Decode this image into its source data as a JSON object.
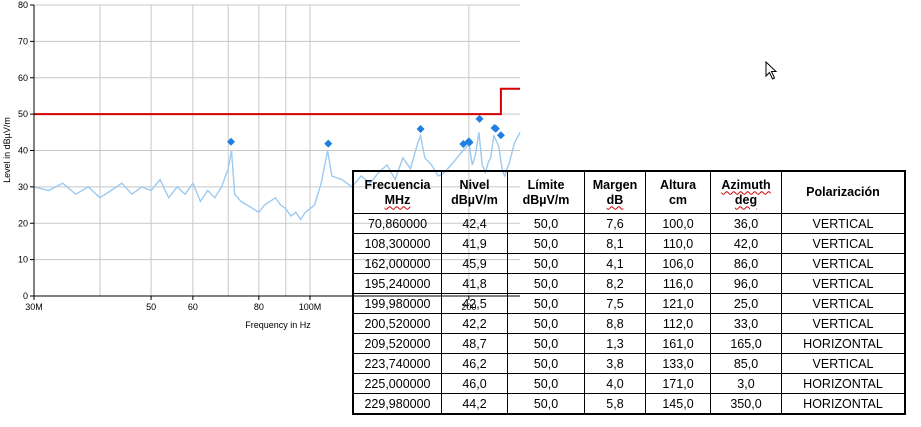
{
  "chart_data": {
    "type": "line",
    "ylabel": "Level in dBµV/m",
    "xlabel": "Frequency in Hz",
    "x_scale": "log",
    "xlim": [
      30,
      250
    ],
    "ylim": [
      0,
      80
    ],
    "y_ticks": [
      "0",
      "10",
      "20",
      "30",
      "40",
      "50",
      "60",
      "70",
      "80"
    ],
    "x_ticks": [
      {
        "label": "30M",
        "value": 30
      },
      {
        "label": "50",
        "value": 50
      },
      {
        "label": "60",
        "value": 60
      },
      {
        "label": "80",
        "value": 80
      },
      {
        "label": "100M",
        "value": 100
      },
      {
        "label": "200",
        "value": 200
      }
    ],
    "grid": true,
    "limit_line": {
      "color": "#d40000",
      "points": [
        [
          30,
          50
        ],
        [
          230,
          50
        ],
        [
          230,
          57
        ],
        [
          250,
          57
        ]
      ]
    },
    "trace": {
      "color": "#9ccaf1",
      "points": [
        [
          30,
          30
        ],
        [
          32,
          29
        ],
        [
          34,
          31
        ],
        [
          36,
          28
        ],
        [
          38,
          30
        ],
        [
          40,
          27
        ],
        [
          42,
          29
        ],
        [
          44,
          31
        ],
        [
          46,
          28
        ],
        [
          48,
          30
        ],
        [
          50,
          29
        ],
        [
          52,
          32
        ],
        [
          54,
          27
        ],
        [
          56,
          30
        ],
        [
          58,
          28
        ],
        [
          60,
          31
        ],
        [
          62,
          26
        ],
        [
          64,
          29
        ],
        [
          66,
          27
        ],
        [
          68,
          30
        ],
        [
          70,
          35
        ],
        [
          71,
          40
        ],
        [
          72,
          28
        ],
        [
          74,
          26
        ],
        [
          76,
          25
        ],
        [
          78,
          24
        ],
        [
          80,
          23
        ],
        [
          82,
          25
        ],
        [
          84,
          26
        ],
        [
          86,
          27
        ],
        [
          88,
          25
        ],
        [
          90,
          24
        ],
        [
          92,
          22
        ],
        [
          94,
          23
        ],
        [
          96,
          21
        ],
        [
          98,
          23
        ],
        [
          100,
          24
        ],
        [
          102,
          25
        ],
        [
          105,
          31
        ],
        [
          108,
          40
        ],
        [
          110,
          33
        ],
        [
          115,
          32
        ],
        [
          120,
          30
        ],
        [
          125,
          33
        ],
        [
          130,
          31
        ],
        [
          135,
          34
        ],
        [
          140,
          36
        ],
        [
          145,
          32
        ],
        [
          150,
          38
        ],
        [
          155,
          35
        ],
        [
          160,
          42
        ],
        [
          162,
          44
        ],
        [
          165,
          38
        ],
        [
          170,
          36
        ],
        [
          175,
          33
        ],
        [
          180,
          34
        ],
        [
          185,
          36
        ],
        [
          190,
          38
        ],
        [
          195,
          40
        ],
        [
          198,
          41
        ],
        [
          200,
          42
        ],
        [
          203,
          36
        ],
        [
          206,
          39
        ],
        [
          209,
          45
        ],
        [
          212,
          36
        ],
        [
          215,
          34
        ],
        [
          218,
          37
        ],
        [
          220,
          38
        ],
        [
          223,
          44
        ],
        [
          225,
          43
        ],
        [
          228,
          41
        ],
        [
          230,
          37
        ],
        [
          232,
          34
        ],
        [
          234,
          33
        ],
        [
          236,
          35
        ],
        [
          238,
          36
        ],
        [
          240,
          38
        ],
        [
          242,
          40
        ],
        [
          244,
          42
        ],
        [
          246,
          43
        ],
        [
          248,
          44
        ],
        [
          250,
          45
        ]
      ]
    },
    "markers": [
      {
        "x": 70.86,
        "y": 42.4
      },
      {
        "x": 108.3,
        "y": 41.9
      },
      {
        "x": 162.0,
        "y": 45.9
      },
      {
        "x": 195.24,
        "y": 41.8
      },
      {
        "x": 199.98,
        "y": 42.5
      },
      {
        "x": 200.52,
        "y": 42.2
      },
      {
        "x": 209.52,
        "y": 48.7
      },
      {
        "x": 223.74,
        "y": 46.2
      },
      {
        "x": 225.0,
        "y": 46.0
      },
      {
        "x": 229.98,
        "y": 44.2
      }
    ],
    "marker_color": "#1e7fe0"
  },
  "table": {
    "headers": [
      {
        "line1": "Frecuencia",
        "line2": "MHz"
      },
      {
        "line1": "Nivel",
        "line2": "dBµV/m"
      },
      {
        "line1": "Límite",
        "line2": "dBµV/m"
      },
      {
        "line1": "Margen",
        "line2": "dB"
      },
      {
        "line1": "Altura",
        "line2": "cm"
      },
      {
        "line1": "Azimuth",
        "line2": "deg"
      },
      {
        "line1": "Polarización",
        "line2": ""
      }
    ],
    "rows": [
      [
        "70,860000",
        "42,4",
        "50,0",
        "7,6",
        "100,0",
        "36,0",
        "VERTICAL"
      ],
      [
        "108,300000",
        "41,9",
        "50,0",
        "8,1",
        "110,0",
        "42,0",
        "VERTICAL"
      ],
      [
        "162,000000",
        "45,9",
        "50,0",
        "4,1",
        "106,0",
        "86,0",
        "VERTICAL"
      ],
      [
        "195,240000",
        "41,8",
        "50,0",
        "8,2",
        "116,0",
        "96,0",
        "VERTICAL"
      ],
      [
        "199,980000",
        "42,5",
        "50,0",
        "7,5",
        "121,0",
        "25,0",
        "VERTICAL"
      ],
      [
        "200,520000",
        "42,2",
        "50,0",
        "8,8",
        "112,0",
        "33,0",
        "VERTICAL"
      ],
      [
        "209,520000",
        "48,7",
        "50,0",
        "1,3",
        "161,0",
        "165,0",
        "HORIZONTAL"
      ],
      [
        "223,740000",
        "46,2",
        "50,0",
        "3,8",
        "133,0",
        "85,0",
        "VERTICAL"
      ],
      [
        "225,000000",
        "46,0",
        "50,0",
        "4,0",
        "171,0",
        "3,0",
        "HORIZONTAL"
      ],
      [
        "229,980000",
        "44,2",
        "50,0",
        "5,8",
        "145,0",
        "350,0",
        "HORIZONTAL"
      ]
    ]
  }
}
